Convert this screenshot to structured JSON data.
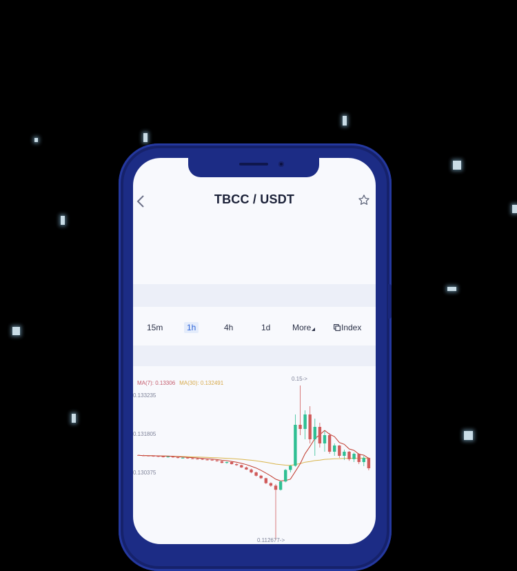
{
  "header": {
    "pair": "TBCC / USDT",
    "back_icon": "chevron-left-icon",
    "favorite_icon": "star-icon"
  },
  "intervals": {
    "items": [
      "15m",
      "1h",
      "4h",
      "1d",
      "More"
    ],
    "active": "1h",
    "index_label": "Index",
    "index_icon": "copy-icon"
  },
  "chart_data": {
    "type": "candlestick",
    "legend": {
      "ma7": "MA(7): 0.13306",
      "ma30": "MA(30): 0.132491"
    },
    "y_tick_labels": [
      "0.133235",
      "0.131805",
      "0.130375"
    ],
    "high_marker": "0.15->",
    "low_marker": "0.112677->",
    "colors": {
      "up": "#2fbf93",
      "down": "#d05a5a",
      "ma7": "#c0392b",
      "ma30": "#d9b44a"
    },
    "candles": [
      [
        0.1332,
        0.1333,
        0.133,
        0.1331
      ],
      [
        0.1331,
        0.13325,
        0.13295,
        0.13305
      ],
      [
        0.13305,
        0.13315,
        0.1329,
        0.133
      ],
      [
        0.133,
        0.1331,
        0.1328,
        0.13295
      ],
      [
        0.13295,
        0.133,
        0.1327,
        0.13285
      ],
      [
        0.13285,
        0.13295,
        0.1326,
        0.13275
      ],
      [
        0.13275,
        0.1329,
        0.1326,
        0.1328
      ],
      [
        0.1328,
        0.13285,
        0.13255,
        0.13265
      ],
      [
        0.13265,
        0.13275,
        0.1324,
        0.1325
      ],
      [
        0.1325,
        0.13265,
        0.13235,
        0.13255
      ],
      [
        0.13255,
        0.1326,
        0.1323,
        0.1324
      ],
      [
        0.1324,
        0.1325,
        0.1322,
        0.1323
      ],
      [
        0.1323,
        0.13245,
        0.13215,
        0.13225
      ],
      [
        0.13225,
        0.13235,
        0.132,
        0.1321
      ],
      [
        0.1321,
        0.1322,
        0.1319,
        0.13205
      ],
      [
        0.13205,
        0.1321,
        0.1318,
        0.1319
      ],
      [
        0.1319,
        0.132,
        0.1316,
        0.1317
      ],
      [
        0.1317,
        0.1318,
        0.1312,
        0.1313
      ],
      [
        0.1313,
        0.1316,
        0.1311,
        0.1315
      ],
      [
        0.1315,
        0.1316,
        0.1309,
        0.131
      ],
      [
        0.131,
        0.1312,
        0.1306,
        0.13075
      ],
      [
        0.13075,
        0.13085,
        0.1301,
        0.1302
      ],
      [
        0.1302,
        0.1304,
        0.1296,
        0.1297
      ],
      [
        0.1297,
        0.1299,
        0.1288,
        0.129
      ],
      [
        0.129,
        0.1292,
        0.128,
        0.1282
      ],
      [
        0.1282,
        0.1284,
        0.1274,
        0.1276
      ],
      [
        0.1276,
        0.1277,
        0.1262,
        0.1264
      ],
      [
        0.1264,
        0.1266,
        0.1255,
        0.1258
      ],
      [
        0.1258,
        0.1262,
        0.11267,
        0.1248
      ],
      [
        0.1248,
        0.127,
        0.1246,
        0.1268
      ],
      [
        0.1268,
        0.1298,
        0.1266,
        0.1296
      ],
      [
        0.1296,
        0.1308,
        0.129,
        0.1306
      ],
      [
        0.1306,
        0.143,
        0.1304,
        0.1405
      ],
      [
        0.1405,
        0.15,
        0.138,
        0.1395
      ],
      [
        0.1395,
        0.144,
        0.137,
        0.143
      ],
      [
        0.143,
        0.145,
        0.136,
        0.137
      ],
      [
        0.137,
        0.142,
        0.133,
        0.14
      ],
      [
        0.14,
        0.141,
        0.135,
        0.136
      ],
      [
        0.136,
        0.139,
        0.134,
        0.138
      ],
      [
        0.138,
        0.1385,
        0.1335,
        0.134
      ],
      [
        0.134,
        0.136,
        0.133,
        0.1355
      ],
      [
        0.1355,
        0.1356,
        0.1325,
        0.133
      ],
      [
        0.133,
        0.1345,
        0.132,
        0.134
      ],
      [
        0.134,
        0.1342,
        0.1318,
        0.1322
      ],
      [
        0.1322,
        0.1338,
        0.1315,
        0.1335
      ],
      [
        0.1335,
        0.1336,
        0.131,
        0.1315
      ],
      [
        0.1315,
        0.133,
        0.1305,
        0.1325
      ],
      [
        0.1325,
        0.1326,
        0.1295,
        0.13
      ]
    ]
  }
}
